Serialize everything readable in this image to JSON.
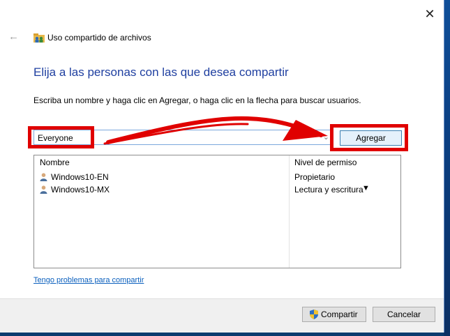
{
  "window": {
    "title": "Uso compartido de archivos",
    "close_glyph": "✕",
    "back_glyph": "←"
  },
  "heading": "Elija a las personas con las que desea compartir",
  "instructions": "Escriba un nombre y haga clic en Agregar, o haga clic en la flecha para buscar usuarios.",
  "name_input": {
    "value": "Everyone",
    "arrow_glyph": "⌄"
  },
  "add_button_label": "Agregar",
  "table": {
    "headers": {
      "name": "Nombre",
      "permission": "Nivel de permiso"
    },
    "rows": [
      {
        "name": "Windows10-EN",
        "permission": "Propietario"
      },
      {
        "name": "Windows10-MX",
        "permission": "Lectura y escritura",
        "dropdown_glyph": "▼"
      }
    ]
  },
  "help_link": "Tengo problemas para compartir",
  "footer": {
    "share_label": "Compartir",
    "cancel_label": "Cancelar"
  },
  "colors": {
    "annotation": "#e00000",
    "heading": "#1f3fa0",
    "link": "#0a5fbd"
  }
}
